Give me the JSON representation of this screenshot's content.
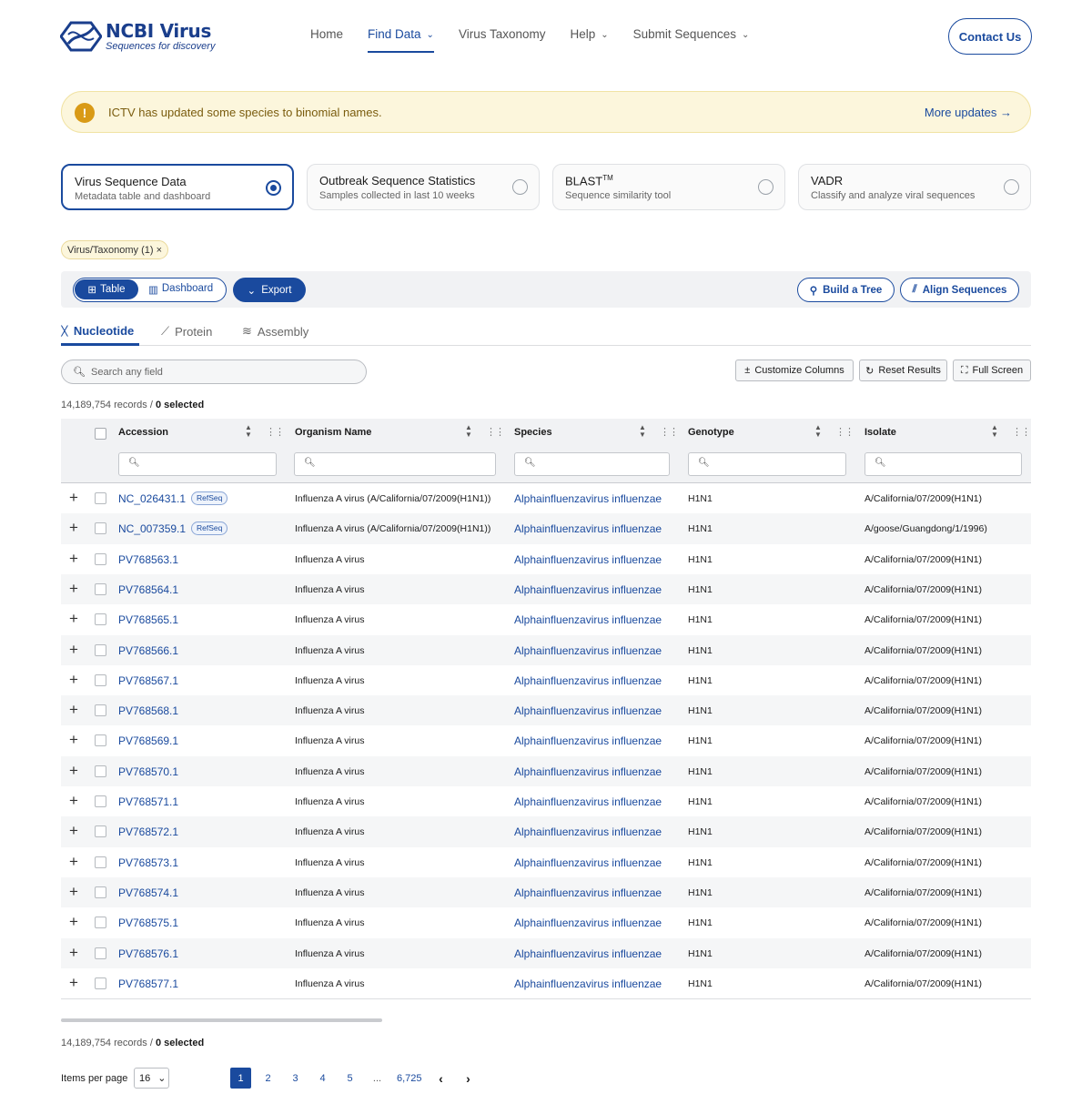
{
  "header": {
    "logo_title": "NCBI Virus",
    "logo_subtitle": "Sequences for discovery",
    "nav": [
      {
        "label": "Home"
      },
      {
        "label": "Find Data"
      },
      {
        "label": "Virus Taxonomy"
      },
      {
        "label": "Help"
      },
      {
        "label": "Submit Sequences"
      }
    ],
    "contact_label": "Contact Us"
  },
  "banner": {
    "icon": "!",
    "text": "ICTV has updated some species to binomial names.",
    "link": "More updates"
  },
  "cards": [
    {
      "title": "Virus Sequence Data",
      "subtitle": "Metadata table and dashboard",
      "selected": true
    },
    {
      "title": "Outbreak Sequence Statistics",
      "subtitle": "Samples collected in last 10 weeks",
      "selected": false
    },
    {
      "title": "BLAST",
      "title_sup": "TM",
      "subtitle": "Sequence similarity tool",
      "selected": false
    },
    {
      "title": "VADR",
      "subtitle": "Classify and analyze viral sequences",
      "selected": false
    }
  ],
  "filter_chip": "Virus/Taxonomy (1)",
  "toolbar": {
    "table_label": "Table",
    "dashboard_label": "Dashboard",
    "export_label": "Export",
    "build_tree_label": "Build a Tree",
    "align_label": "Align Sequences"
  },
  "tabs": [
    {
      "label": "Nucleotide",
      "active": true
    },
    {
      "label": "Protein",
      "active": false
    },
    {
      "label": "Assembly",
      "active": false
    }
  ],
  "search": {
    "placeholder": "Search any field"
  },
  "table_buttons": {
    "customize": "Customize Columns",
    "reset": "Reset Results",
    "fullscreen": "Full Screen"
  },
  "records": {
    "count": "14,189,754 records",
    "separator": " / ",
    "selected": "0 selected"
  },
  "columns": [
    "Accession",
    "Organism Name",
    "Species",
    "Genotype",
    "Isolate"
  ],
  "rows": [
    {
      "accession": "NC_026431.1",
      "refseq": "RefSeq",
      "organism": "Influenza A virus (A/California/07/2009(H1N1))",
      "species": "Alphainfluenzavirus influenzae",
      "genotype": "H1N1",
      "isolate": "A/California/07/2009(H1N1)"
    },
    {
      "accession": "NC_007359.1",
      "refseq": "RefSeq",
      "organism": "Influenza A virus (A/California/07/2009(H1N1))",
      "species": "Alphainfluenzavirus influenzae",
      "genotype": "H1N1",
      "isolate": "A/goose/Guangdong/1/1996)"
    },
    {
      "accession": "PV768563.1",
      "organism": "Influenza A virus",
      "species": "Alphainfluenzavirus influenzae",
      "genotype": "H1N1",
      "isolate": "A/California/07/2009(H1N1)"
    },
    {
      "accession": "PV768564.1",
      "organism": "Influenza A virus",
      "species": "Alphainfluenzavirus influenzae",
      "genotype": "H1N1",
      "isolate": "A/California/07/2009(H1N1)"
    },
    {
      "accession": "PV768565.1",
      "organism": "Influenza A virus",
      "species": "Alphainfluenzavirus influenzae",
      "genotype": "H1N1",
      "isolate": "A/California/07/2009(H1N1)"
    },
    {
      "accession": "PV768566.1",
      "organism": "Influenza A virus",
      "species": "Alphainfluenzavirus influenzae",
      "genotype": "H1N1",
      "isolate": "A/California/07/2009(H1N1)"
    },
    {
      "accession": "PV768567.1",
      "organism": "Influenza A virus",
      "species": "Alphainfluenzavirus influenzae",
      "genotype": "H1N1",
      "isolate": "A/California/07/2009(H1N1)"
    },
    {
      "accession": "PV768568.1",
      "organism": "Influenza A virus",
      "species": "Alphainfluenzavirus influenzae",
      "genotype": "H1N1",
      "isolate": "A/California/07/2009(H1N1)"
    },
    {
      "accession": "PV768569.1",
      "organism": "Influenza A virus",
      "species": "Alphainfluenzavirus influenzae",
      "genotype": "H1N1",
      "isolate": "A/California/07/2009(H1N1)"
    },
    {
      "accession": "PV768570.1",
      "organism": "Influenza A virus",
      "species": "Alphainfluenzavirus influenzae",
      "genotype": "H1N1",
      "isolate": "A/California/07/2009(H1N1)"
    },
    {
      "accession": "PV768571.1",
      "organism": "Influenza A virus",
      "species": "Alphainfluenzavirus influenzae",
      "genotype": "H1N1",
      "isolate": "A/California/07/2009(H1N1)"
    },
    {
      "accession": "PV768572.1",
      "organism": "Influenza A virus",
      "species": "Alphainfluenzavirus influenzae",
      "genotype": "H1N1",
      "isolate": "A/California/07/2009(H1N1)"
    },
    {
      "accession": "PV768573.1",
      "organism": "Influenza A virus",
      "species": "Alphainfluenzavirus influenzae",
      "genotype": "H1N1",
      "isolate": "A/California/07/2009(H1N1)"
    },
    {
      "accession": "PV768574.1",
      "organism": "Influenza A virus",
      "species": "Alphainfluenzavirus influenzae",
      "genotype": "H1N1",
      "isolate": "A/California/07/2009(H1N1)"
    },
    {
      "accession": "PV768575.1",
      "organism": "Influenza A virus",
      "species": "Alphainfluenzavirus influenzae",
      "genotype": "H1N1",
      "isolate": "A/California/07/2009(H1N1)"
    },
    {
      "accession": "PV768576.1",
      "organism": "Influenza A virus",
      "species": "Alphainfluenzavirus influenzae",
      "genotype": "H1N1",
      "isolate": "A/California/07/2009(H1N1)"
    },
    {
      "accession": "PV768577.1",
      "organism": "Influenza A virus",
      "species": "Alphainfluenzavirus influenzae",
      "genotype": "H1N1",
      "isolate": "A/California/07/2009(H1N1)"
    }
  ],
  "pagination": {
    "items_per_page_label": "Items per page",
    "items_per_page": "16",
    "pages": [
      "1",
      "2",
      "3",
      "4",
      "5",
      "...",
      "6,725"
    ],
    "current": "1"
  },
  "colors": {
    "primary": "#1a4a9e",
    "banner_bg": "#fcf6dc",
    "warning": "#d99a16"
  }
}
